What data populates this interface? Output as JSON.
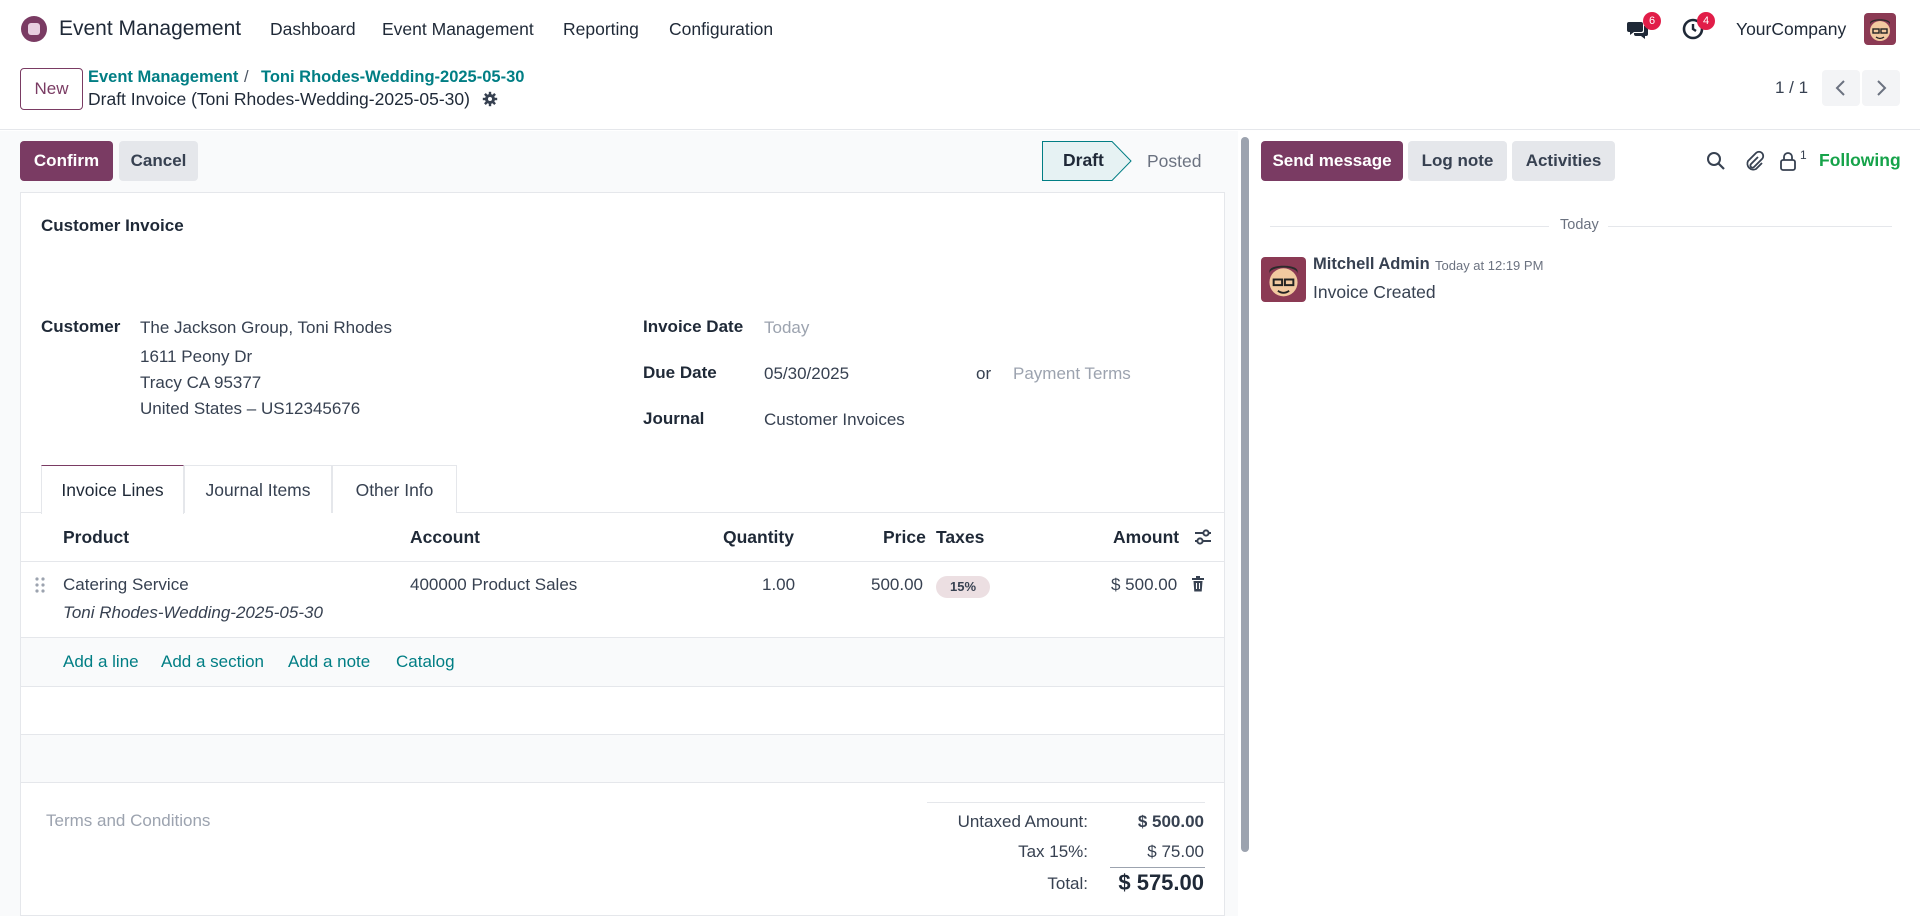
{
  "navbar": {
    "app_name": "Event Management",
    "menu": [
      "Dashboard",
      "Event Management",
      "Reporting",
      "Configuration"
    ],
    "messages_count": "6",
    "activities_count": "4",
    "company": "YourCompany"
  },
  "control_panel": {
    "new_label": "New",
    "breadcrumb": [
      "Event Management",
      "Toni Rhodes-Wedding-2025-05-30"
    ],
    "breadcrumb_sep": "/",
    "record_title": "Draft Invoice (Toni Rhodes-Wedding-2025-05-30)",
    "pager": "1 / 1"
  },
  "actions": {
    "confirm": "Confirm",
    "cancel": "Cancel"
  },
  "statusbar": {
    "active": "Draft",
    "next": "Posted"
  },
  "form": {
    "title": "Customer Invoice",
    "customer_label": "Customer",
    "customer_lines": [
      "The Jackson Group, Toni Rhodes",
      "1611 Peony Dr",
      "Tracy CA 95377",
      "United States – US12345676"
    ],
    "invoice_date_label": "Invoice Date",
    "invoice_date_value": "Today",
    "due_date_label": "Due Date",
    "due_date_value": "05/30/2025",
    "or_text": "or",
    "payment_terms_placeholder": "Payment Terms",
    "journal_label": "Journal",
    "journal_value": "Customer Invoices"
  },
  "tabs": [
    "Invoice Lines",
    "Journal Items",
    "Other Info"
  ],
  "lines_table": {
    "headers": {
      "product": "Product",
      "account": "Account",
      "quantity": "Quantity",
      "price": "Price",
      "taxes": "Taxes",
      "amount": "Amount"
    },
    "rows": [
      {
        "product": "Catering Service",
        "description": "Toni Rhodes-Wedding-2025-05-30",
        "account": "400000 Product Sales",
        "quantity": "1.00",
        "price": "500.00",
        "tax": "15%",
        "amount": "$ 500.00"
      }
    ],
    "add_links": [
      "Add a line",
      "Add a section",
      "Add a note",
      "Catalog"
    ]
  },
  "footer": {
    "terms_placeholder": "Terms and Conditions",
    "untaxed_label": "Untaxed Amount:",
    "untaxed_value": "$ 500.00",
    "tax_label": "Tax 15%:",
    "tax_value": "$ 75.00",
    "total_label": "Total:",
    "total_value": "$ 575.00"
  },
  "chatter": {
    "send_message": "Send message",
    "log_note": "Log note",
    "activities": "Activities",
    "followers_count": "1",
    "following": "Following",
    "date_separator": "Today",
    "message": {
      "author": "Mitchell Admin",
      "time": "Today at 12:19 PM",
      "body": "Invoice Created"
    }
  },
  "colors": {
    "brand": "#7a3b63",
    "link": "#017e84",
    "following": "#16a34a",
    "badge": "#e11d48"
  }
}
